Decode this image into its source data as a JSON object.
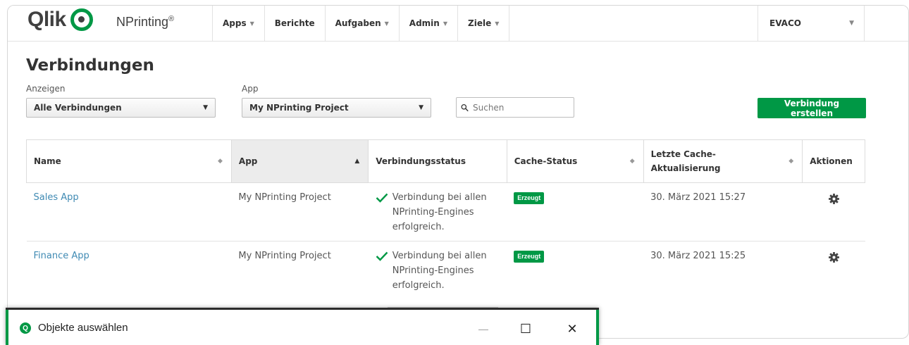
{
  "header": {
    "logo_text": "Qlik",
    "product_name": "NPrinting",
    "product_mark": "®",
    "nav": [
      {
        "label": "Apps",
        "has_menu": true
      },
      {
        "label": "Berichte",
        "has_menu": false
      },
      {
        "label": "Aufgaben",
        "has_menu": true
      },
      {
        "label": "Admin",
        "has_menu": true
      },
      {
        "label": "Ziele",
        "has_menu": true
      }
    ],
    "user": "EVACO"
  },
  "page": {
    "title": "Verbindungen",
    "filters": {
      "show_label": "Anzeigen",
      "show_value": "Alle Verbindungen",
      "app_label": "App",
      "app_value": "My NPrinting Project",
      "search_placeholder": "Suchen"
    },
    "create_button": "Verbindung erstellen"
  },
  "table": {
    "columns": [
      {
        "label": "Name",
        "sortable": true
      },
      {
        "label": "App",
        "sortable": true,
        "sorted": "asc"
      },
      {
        "label": "Verbindungsstatus",
        "sortable": false
      },
      {
        "label": "Cache-Status",
        "sortable": true
      },
      {
        "label": "Letzte Cache-Aktualisierung",
        "sortable": true
      },
      {
        "label": "Aktionen",
        "sortable": false
      }
    ],
    "rows": [
      {
        "name": "Sales App",
        "app": "My NPrinting Project",
        "status": "Verbindung bei allen NPrinting-Engines erfolgreich.",
        "cache_status": "Erzeugt",
        "last_update": "30. März 2021 15:27"
      },
      {
        "name": "Finance App",
        "app": "My NPrinting Project",
        "status": "Verbindung bei allen NPrinting-Engines erfolgreich.",
        "cache_status": "Erzeugt",
        "last_update": "30. März 2021 15:25"
      }
    ]
  },
  "dialog": {
    "icon_letter": "Q",
    "title": "Objekte auswählen",
    "minimize": "—",
    "maximize": "☐",
    "close": "✕"
  },
  "colors": {
    "brand_green": "#009845",
    "link_blue": "#3f8ab3"
  }
}
